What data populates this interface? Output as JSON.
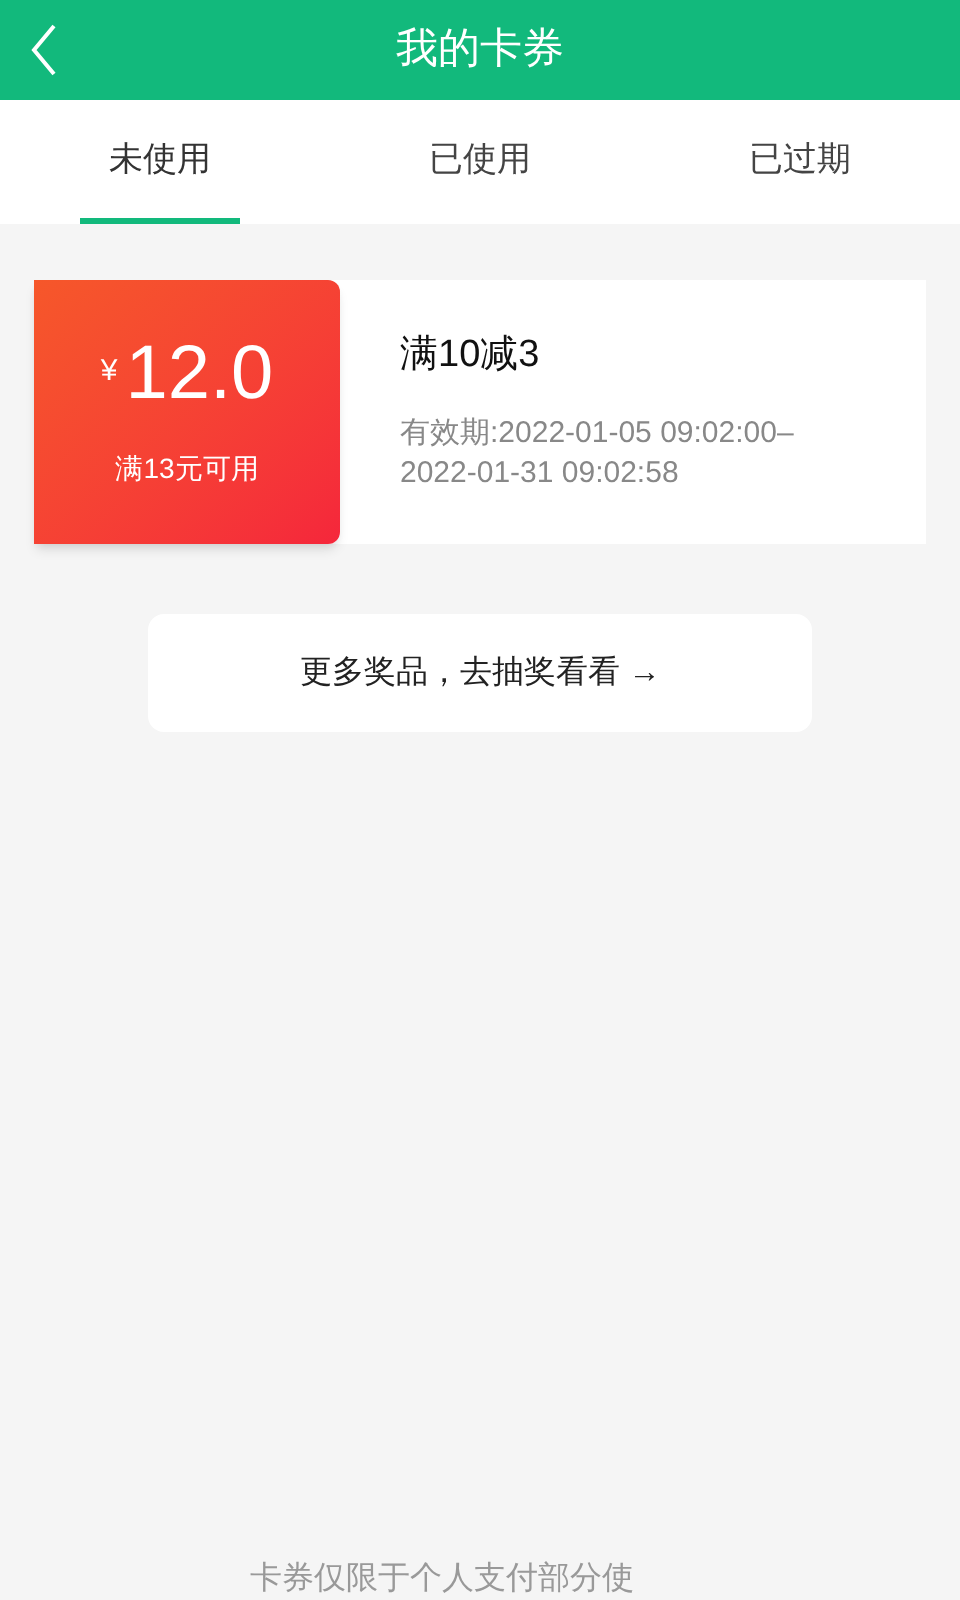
{
  "header": {
    "title": "我的卡券"
  },
  "tabs": [
    {
      "label": "未使用",
      "selected": true
    },
    {
      "label": "已使用",
      "selected": false
    },
    {
      "label": "已过期",
      "selected": false
    }
  ],
  "coupons": [
    {
      "currency": "¥",
      "amount": "12.0",
      "condition": "满13元可用",
      "title": "满10减3",
      "validity": "有效期:2022-01-05 09:02:00–2022-01-31 09:02:58"
    }
  ],
  "more_button": {
    "label": "更多奖品，去抽奖看看 →"
  },
  "footer_note": "卡券仅限于个人支付部分使"
}
